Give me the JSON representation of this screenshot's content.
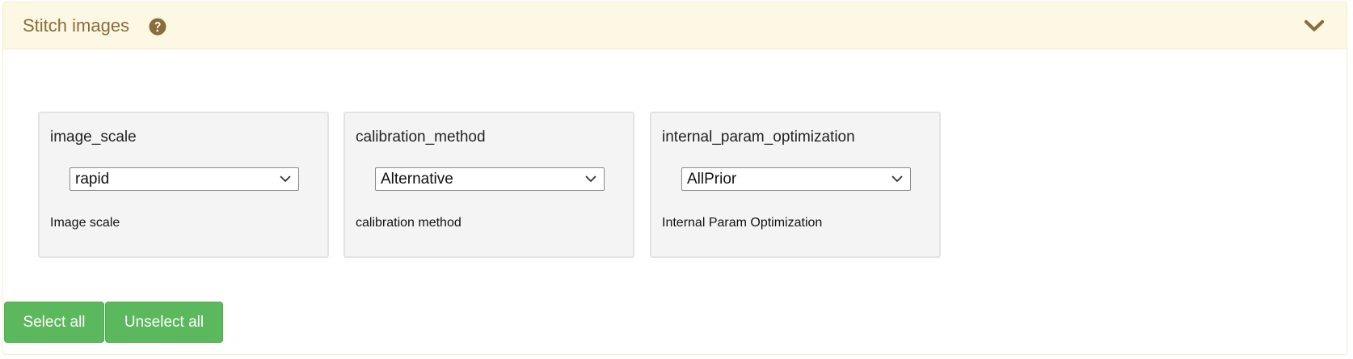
{
  "panel": {
    "title": "Stitch images",
    "help_icon": "question-circle-icon",
    "collapse_icon": "chevron-down-icon",
    "accent_color": "#8a6d3b",
    "heading_bg": "#fcf8e3"
  },
  "options": [
    {
      "name": "image_scale",
      "selected": "rapid",
      "description": "Image scale"
    },
    {
      "name": "calibration_method",
      "selected": "Alternative",
      "description": "calibration method"
    },
    {
      "name": "internal_param_optimization",
      "selected": "AllPrior",
      "description": "Internal Param Optimization"
    }
  ],
  "actions": {
    "select_all_label": "Select all",
    "unselect_all_label": "Unselect all",
    "button_color": "#5cb85c"
  }
}
